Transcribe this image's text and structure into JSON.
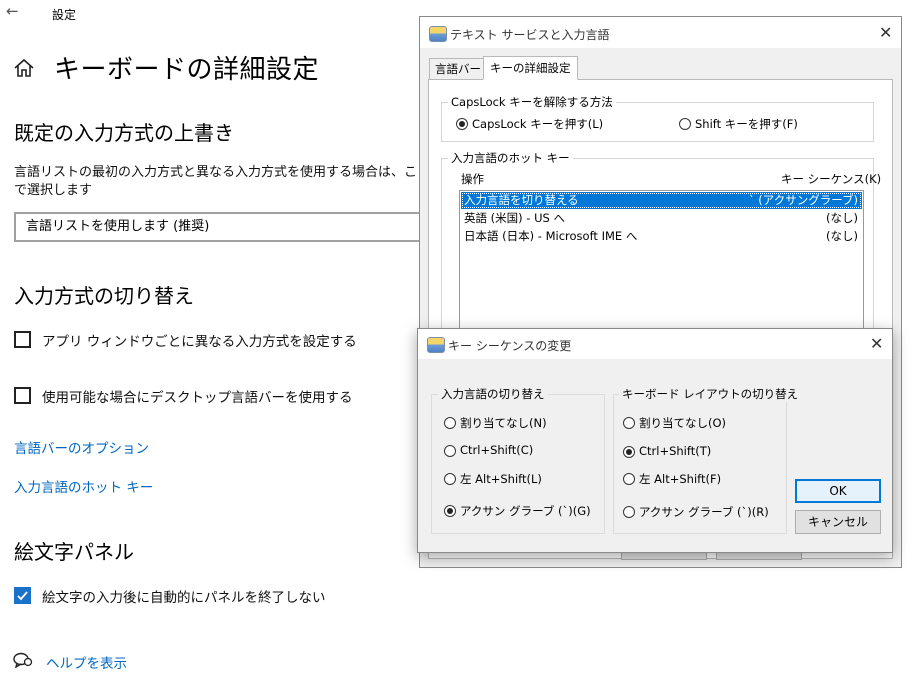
{
  "settings": {
    "app_title": "設定",
    "back_icon": "←",
    "page_title": "キーボードの詳細設定",
    "override_section": "既定の入力方式の上書き",
    "override_desc": "言語リストの最初の入力方式と異なる入力方式を使用する場合は、ここで選択します",
    "dropdown_value": "言語リストを使用します (推奨)",
    "switch_section": "入力方式の切り替え",
    "checkbox1_label": "アプリ ウィンドウごとに異なる入力方式を設定する",
    "checkbox1_checked": false,
    "checkbox2_label": "使用可能な場合にデスクトップ言語バーを使用する",
    "checkbox2_checked": false,
    "link_langbar_options": "言語バーのオプション",
    "link_hotkeys": "入力言語のホット キー",
    "emoji_section": "絵文字パネル",
    "checkbox3_label": "絵文字の入力後に自動的にパネルを終了しない",
    "checkbox3_checked": true,
    "help_link": "ヘルプを表示"
  },
  "text_services_dialog": {
    "title": "テキスト サービスと入力言語",
    "close_glyph": "✕",
    "tabs": [
      {
        "label": "言語バー",
        "active": false
      },
      {
        "label": "キーの詳細設定",
        "active": true
      }
    ],
    "capslock_group": "CapsLock キーを解除する方法",
    "capslock_options": [
      {
        "label": "CapsLock キーを押す(L)",
        "selected": true
      },
      {
        "label": "Shift キーを押す(F)",
        "selected": false
      }
    ],
    "hotkeys_group": "入力言語のホット キー",
    "col_action": "操作",
    "col_key_sequence": "キー シーケンス(K)",
    "hotkey_rows": [
      {
        "action": "入力言語を切り替える",
        "keys": "` (アクサングラーブ)",
        "selected": true
      },
      {
        "action": "英語 (米国) - US へ",
        "keys": "(なし)",
        "selected": false
      },
      {
        "action": "日本語 (日本) - Microsoft IME へ",
        "keys": "(なし)",
        "selected": false
      }
    ]
  },
  "key_sequence_dialog": {
    "title": "キー シーケンスの変更",
    "close_glyph": "✕",
    "input_lang_group": "入力言語の切り替え",
    "input_lang_options": [
      {
        "label": "割り当てなし(N)",
        "selected": false
      },
      {
        "label": "Ctrl+Shift(C)",
        "selected": false
      },
      {
        "label": "左 Alt+Shift(L)",
        "selected": false
      },
      {
        "label": "アクサン グラーブ (`)(G)",
        "selected": true
      }
    ],
    "layout_group": "キーボード レイアウトの切り替え",
    "layout_options": [
      {
        "label": "割り当てなし(O)",
        "selected": false
      },
      {
        "label": "Ctrl+Shift(T)",
        "selected": true
      },
      {
        "label": "左 Alt+Shift(F)",
        "selected": false
      },
      {
        "label": "アクサン グラーブ (`)(R)",
        "selected": false
      }
    ],
    "ok_label": "OK",
    "cancel_label": "キャンセル"
  },
  "colors": {
    "accent": "#0078d7",
    "link": "#0067c0"
  }
}
